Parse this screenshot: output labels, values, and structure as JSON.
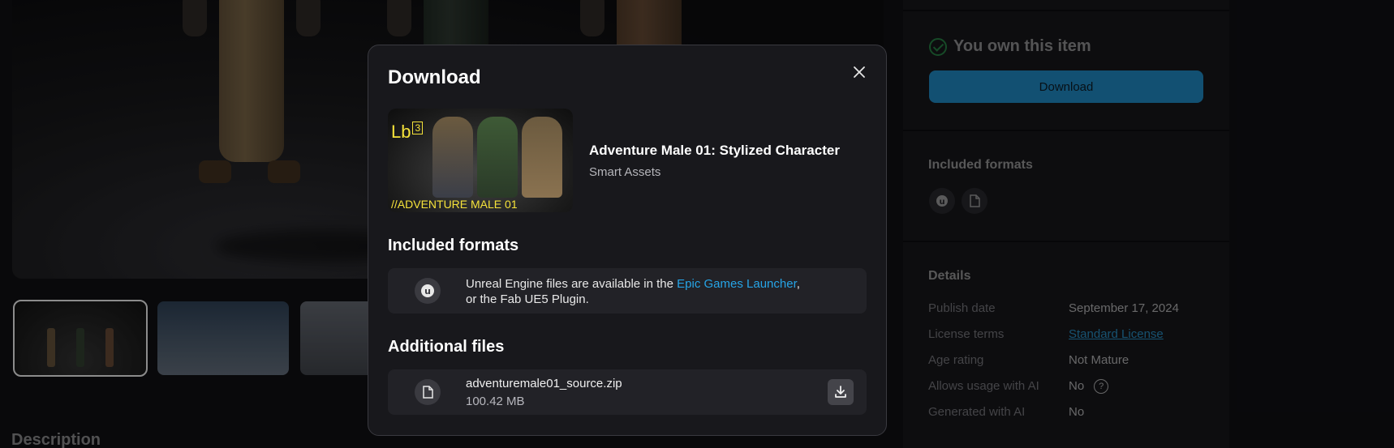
{
  "background": {
    "description_heading": "Description"
  },
  "sidebar": {
    "owned_text": "You own this item",
    "download_label": "Download",
    "included_formats_title": "Included formats",
    "format_icons": [
      "unreal-engine-icon",
      "file-icon"
    ],
    "details_title": "Details",
    "details": [
      {
        "key": "Publish date",
        "value": "September 17, 2024"
      },
      {
        "key": "License terms",
        "value": "Standard License"
      },
      {
        "key": "Age rating",
        "value": "Not Mature"
      },
      {
        "key": "Allows usage with AI",
        "value": "No"
      },
      {
        "key": "Generated with AI",
        "value": "No"
      }
    ]
  },
  "modal": {
    "title": "Download",
    "product": {
      "badge_text": "Lb",
      "badge_number": "3",
      "image_caption": "//ADVENTURE MALE 01",
      "name": "Adventure Male 01: Stylized Character",
      "seller": "Smart Assets"
    },
    "included_formats": {
      "title": "Included formats",
      "text_before": "Unreal Engine files are available in the ",
      "link": "Epic Games Launcher",
      "text_after": ",",
      "line2": "or the Fab UE5 Plugin."
    },
    "additional_files": {
      "title": "Additional files",
      "file_name": "adventuremale01_source.zip",
      "file_size": "100.42 MB"
    }
  },
  "colors": {
    "accent": "#26a4e6",
    "owned": "#2ec05a",
    "badge": "#f5e23a"
  }
}
